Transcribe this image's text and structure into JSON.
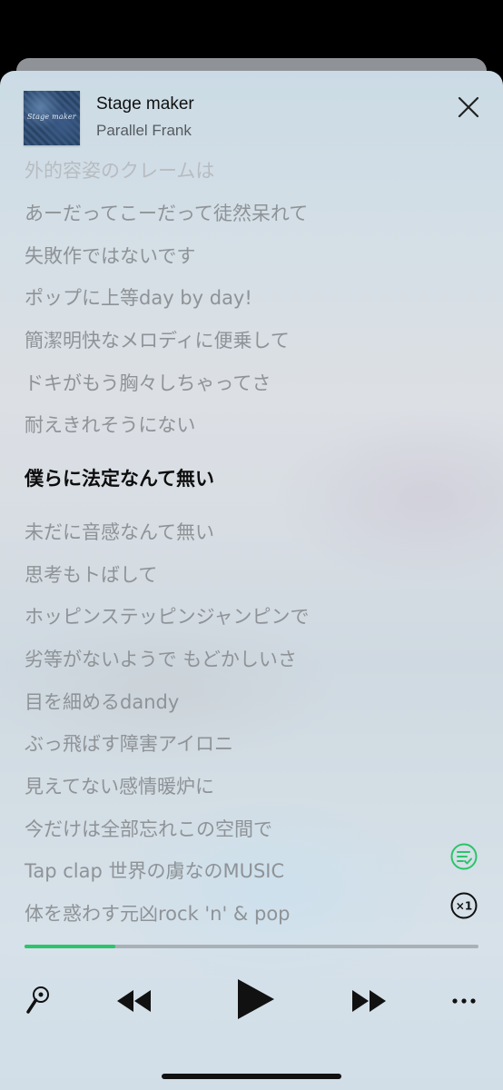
{
  "song": {
    "title": "Stage maker",
    "artist": "Parallel Frank",
    "album_art_text": "Stage maker"
  },
  "lyrics": [
    {
      "text": "外的容姿のクレームは",
      "state": "faded"
    },
    {
      "text": "あーだってこーだって徒然呆れて",
      "state": "normal"
    },
    {
      "text": "失敗作ではないです",
      "state": "normal"
    },
    {
      "text": "ポップに上等day by day!",
      "state": "normal"
    },
    {
      "text": "簡潔明快なメロディに便乗して",
      "state": "normal"
    },
    {
      "text": "ドキがもう胸々しちゃってさ",
      "state": "normal"
    },
    {
      "text": "耐えきれそうにない",
      "state": "normal"
    },
    {
      "text": "僕らに法定なんて無い",
      "state": "active"
    },
    {
      "text": "未だに音感なんて無い",
      "state": "normal"
    },
    {
      "text": "思考もトばして",
      "state": "normal"
    },
    {
      "text": "ホッピンステッピンジャンピンで",
      "state": "normal"
    },
    {
      "text": "劣等がないようで もどかしいさ",
      "state": "normal"
    },
    {
      "text": "目を細めるdandy",
      "state": "normal"
    },
    {
      "text": "ぶっ飛ばす障害アイロニ",
      "state": "normal"
    },
    {
      "text": "見えてない感情暖炉に",
      "state": "normal"
    },
    {
      "text": "今だけは全部忘れこの空間で",
      "state": "normal"
    },
    {
      "text": "Tap clap 世界の虜なのMUSIC",
      "state": "normal"
    },
    {
      "text": "体を惑わす元凶rock 'n' & pop",
      "state": "normal"
    }
  ],
  "playback": {
    "progress": 0.2,
    "speed_label": "×1"
  },
  "icons": {
    "close": "close-icon",
    "lyrics_sync": "lyrics-sync-icon",
    "speed": "speed-icon",
    "karaoke": "microphone-icon",
    "rewind": "rewind-icon",
    "play": "play-icon",
    "fast_forward": "fast-forward-icon",
    "more": "more-icon"
  },
  "colors": {
    "accent": "#2bc46a",
    "active_lyric": "#0d0d0d",
    "inactive_lyric": "#8e9397"
  }
}
